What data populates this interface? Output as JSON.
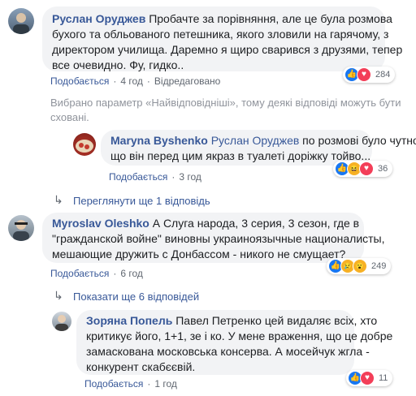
{
  "comments": [
    {
      "author": "Руслан Оруджев",
      "line1": "Пробачте за порівняння, але це була розмова",
      "line2": "бухого та обльованого петешника, якого зловили на гарячому, з",
      "line3": "директором училища. Даремно я щиро сварився з друзями, тепер",
      "line4": "все очевидно. Фу, гидко..",
      "like_label": "Подобається",
      "time": "4 год",
      "edited": "Відредаговано",
      "reaction_count": "284",
      "reactions": [
        "like-icon",
        "love-icon"
      ]
    }
  ],
  "notice": {
    "line1": "Вибрано параметр «Найвідповідніші», тому деякі відповіді можуть бути",
    "line2": "сховані."
  },
  "reply1": {
    "author": "Maryna Byshenko",
    "mention": "Руслан Оруджев",
    "line1_rest": " по розмові було чутно,",
    "line2": "що він перед цим якраз в туалеті доріжку тойво...",
    "like_label": "Подобається",
    "time": "3 год",
    "reaction_count": "36",
    "reactions": [
      "like-icon",
      "haha-icon",
      "love-icon"
    ]
  },
  "more_replies_1": "Переглянути ще 1 відповідь",
  "comment2": {
    "author": "Myroslav Oleshko",
    "line1_rest": " А Слуга народа, 3 серия, 3 сезон, где в",
    "line2": "\"гражданской войне\" виновны украиноязычные националисты,",
    "line3": "мешающие дружить с Донбассом - никого не смущает?",
    "like_label": "Подобається",
    "time": "6 год",
    "reaction_count": "249",
    "reactions": [
      "like-icon",
      "sad-icon",
      "wow-icon"
    ]
  },
  "more_replies_2": "Показати ще 6 відповідей",
  "reply2": {
    "author": "Зоряна Попель",
    "line1_rest": " Павел Петренко цей видаляє всіх, хто",
    "line2": "критикує його, 1+1, зе і ко. У мене враження, що це добре",
    "line3": "замаскована московська консерва. А мосейчук жгла -",
    "line4": "конкурент скабєєвій.",
    "like_label": "Подобається",
    "time": "1 год",
    "reaction_count": "11",
    "reactions": [
      "like-icon",
      "love-icon"
    ]
  },
  "separator": "·",
  "colors": {
    "link": "#385898",
    "bubble": "#f2f3f5",
    "like": "#1877f2",
    "love": "#f33e58",
    "yellow": "#f7b125"
  }
}
